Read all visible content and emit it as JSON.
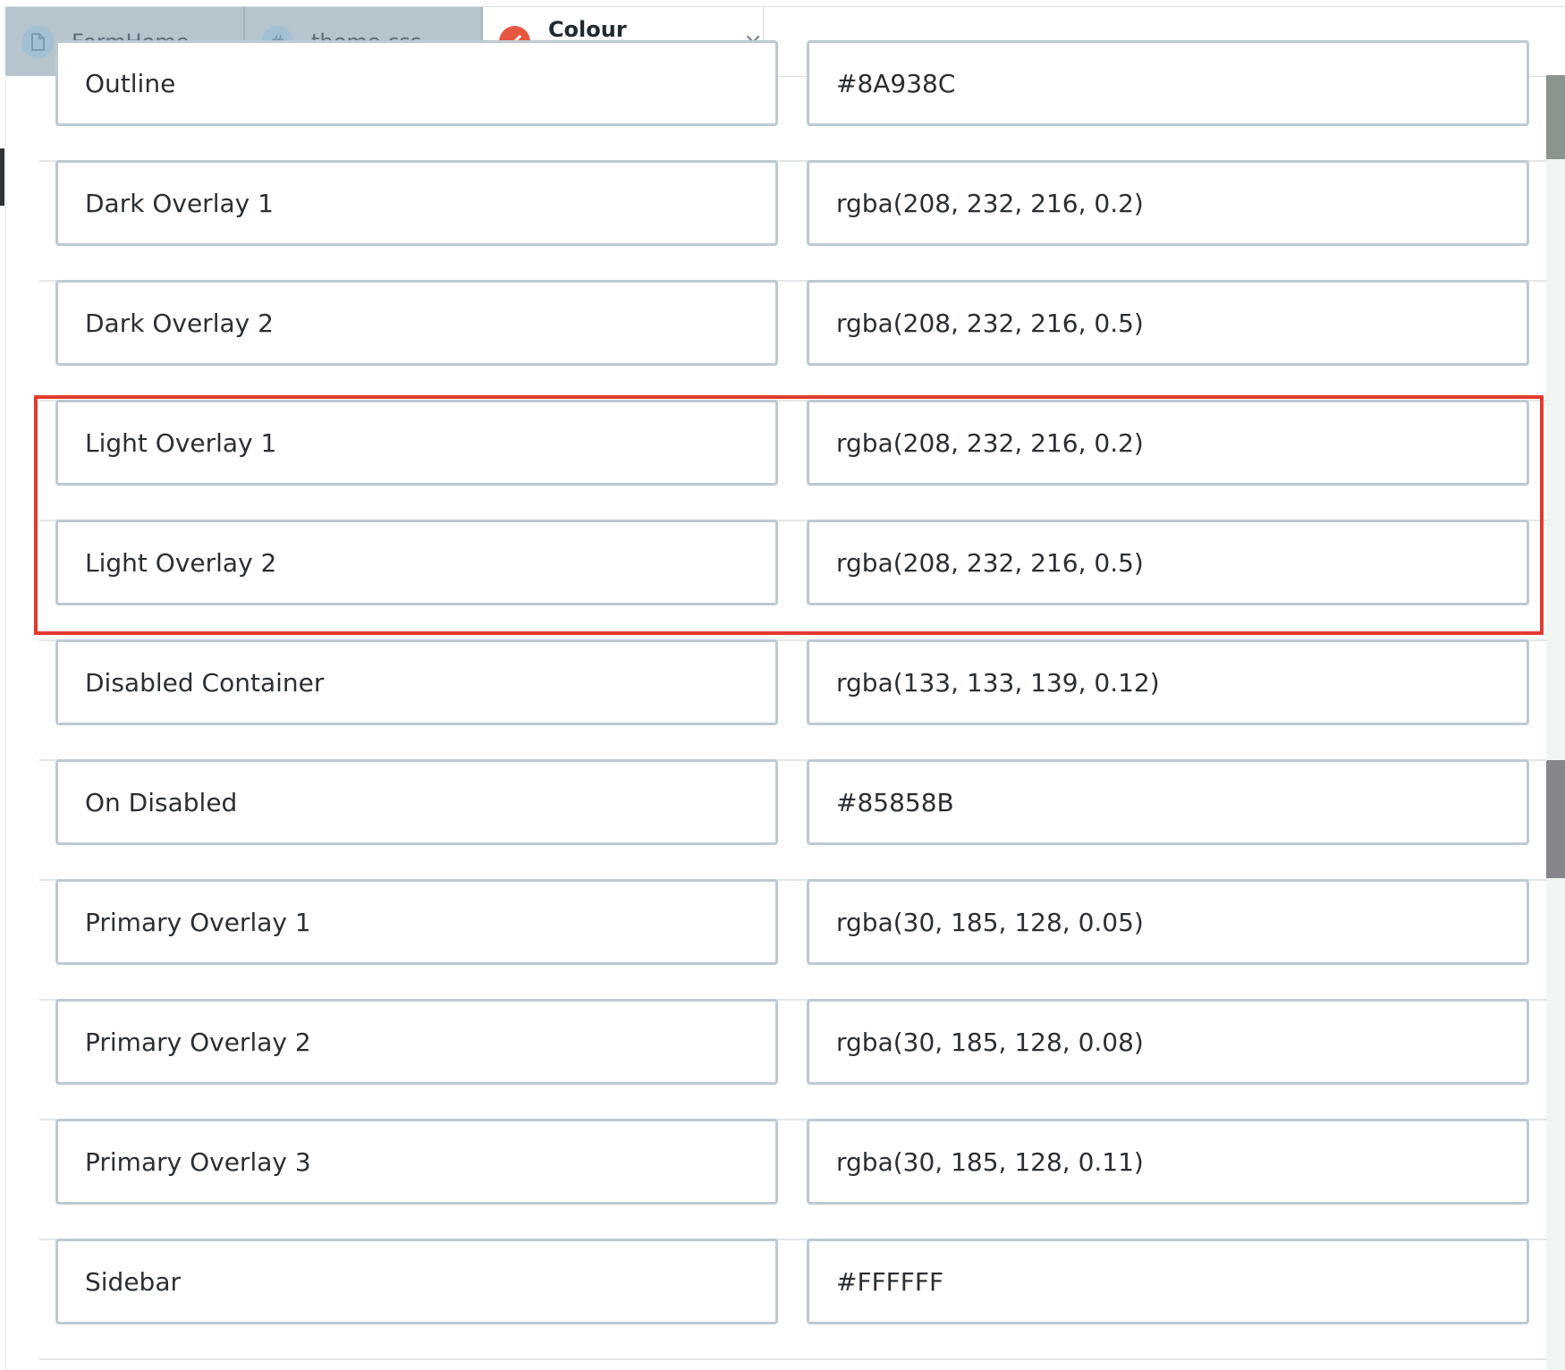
{
  "tabs": [
    {
      "label": "FormHome",
      "icon": "file-icon",
      "active": false
    },
    {
      "label": "theme.css",
      "icon": "hash-icon",
      "active": false
    },
    {
      "label": "Colour Scheme",
      "icon": "paint-brush-icon",
      "active": true,
      "close": "×"
    }
  ],
  "rows": [
    {
      "name": "Outline",
      "value": "#8A938C"
    },
    {
      "name": "Dark Overlay 1",
      "value": "rgba(208, 232, 216, 0.2)"
    },
    {
      "name": "Dark Overlay 2",
      "value": "rgba(208, 232, 216, 0.5)"
    },
    {
      "name": "Light Overlay 1",
      "value": "rgba(208, 232, 216, 0.2)"
    },
    {
      "name": "Light Overlay 2",
      "value": "rgba(208, 232, 216, 0.5)"
    },
    {
      "name": "Disabled Container",
      "value": "rgba(133, 133, 139, 0.12)"
    },
    {
      "name": "On Disabled",
      "value": "#85858B"
    },
    {
      "name": "Primary Overlay 1",
      "value": "rgba(30, 185, 128, 0.05)"
    },
    {
      "name": "Primary Overlay 2",
      "value": "rgba(30, 185, 128, 0.08)"
    },
    {
      "name": "Primary Overlay 3",
      "value": "rgba(30, 185, 128, 0.11)"
    },
    {
      "name": "Sidebar",
      "value": "#FFFFFF"
    }
  ],
  "colors": {
    "highlight": "#E23A2C",
    "active_tab_icon": "#E8573F",
    "inactive_tab": "#B6C4CD"
  }
}
